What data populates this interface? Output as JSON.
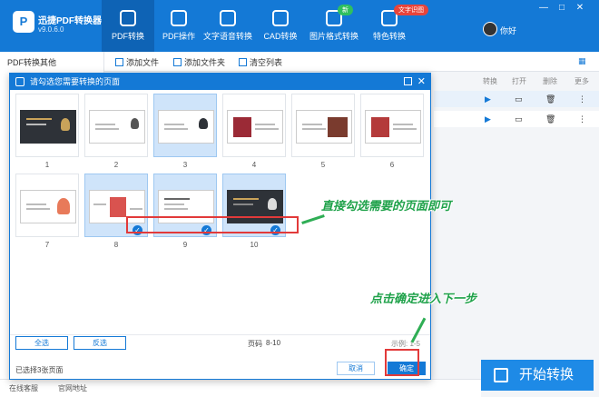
{
  "app": {
    "name": "迅捷PDF转换器",
    "version": "v9.0.6.0",
    "logo": "P"
  },
  "nav": [
    {
      "label": "PDF转换",
      "icon": "convert-icon"
    },
    {
      "label": "PDF操作",
      "icon": "pdf-ops-icon"
    },
    {
      "label": "文字语音转换",
      "icon": "voice-icon"
    },
    {
      "label": "CAD转换",
      "icon": "cad-icon"
    },
    {
      "label": "图片格式转换",
      "icon": "image-icon"
    },
    {
      "label": "特色转换",
      "icon": "feature-icon"
    }
  ],
  "badges": {
    "new": "新",
    "tts": "文字识图"
  },
  "user": {
    "name": "你好"
  },
  "window": {
    "minimize": "—",
    "maximize": "□",
    "close": "✕"
  },
  "sidebar": {
    "title": "PDF转换其他"
  },
  "toolbar": {
    "add_file": "添加文件",
    "add_folder": "添加文件夹",
    "clear_list": "清空列表"
  },
  "list_header": {
    "convert": "转换",
    "open": "打开",
    "delete": "删除",
    "more": "更多"
  },
  "row_icons": {
    "play": "▶",
    "folder": "▭",
    "trash": "🗑",
    "more": "⋮"
  },
  "dialog": {
    "title": "请勾选您需要转换的页面",
    "pages": [
      "1",
      "2",
      "3",
      "4",
      "5",
      "6",
      "7",
      "8",
      "9",
      "10"
    ],
    "check_mark": "✓",
    "select_all": "全选",
    "invert": "反选",
    "page_range_label": "页码",
    "page_range_value": "8-10",
    "example": "示例: 1-5",
    "selected_count": "已选择3张页面",
    "cancel": "取消",
    "confirm": "确定"
  },
  "annotations": {
    "select_pages": "直接勾选需要的页面即可",
    "click_confirm": "点击确定进入下一步"
  },
  "start_button": "开始转换",
  "footer": {
    "online": "在线客服",
    "website": "官网地址"
  },
  "colors": {
    "brand": "#1479d6",
    "annotation": "#1fa24a",
    "highlight": "#e23a3a"
  }
}
